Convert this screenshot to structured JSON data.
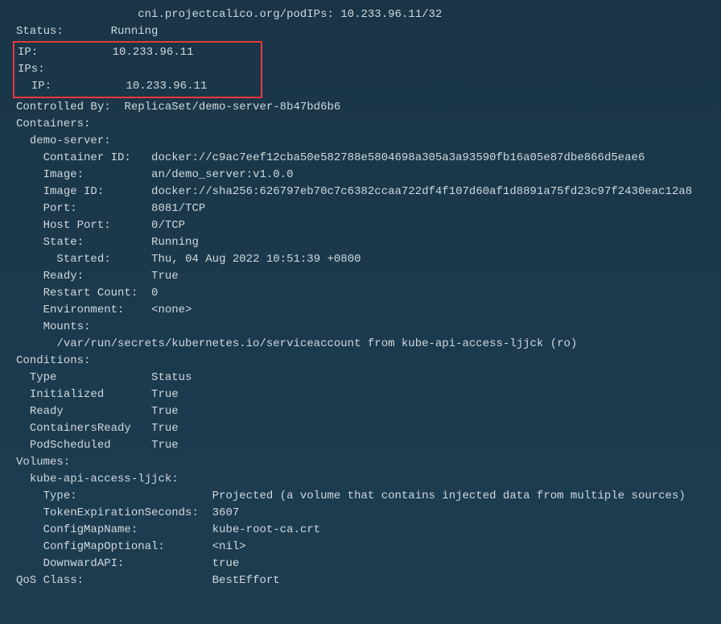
{
  "annotation": {
    "key": "cni.projectcalico.org/podIPs:",
    "value": "10.233.96.11/32"
  },
  "status": {
    "label": "Status:",
    "value": "Running"
  },
  "ip_section": {
    "ip_label": "IP:",
    "ip_value": "10.233.96.11",
    "ips_label": "IPs:",
    "nested_ip_label": "IP:",
    "nested_ip_value": "10.233.96.11"
  },
  "controlled_by": {
    "label": "Controlled By:",
    "value": "ReplicaSet/demo-server-8b47bd6b6"
  },
  "containers": {
    "label": "Containers:",
    "name": "demo-server:",
    "container_id": {
      "label": "Container ID:",
      "value": "docker://c9ac7eef12cba50e582788e5804698a305a3a93590fb16a05e87dbe866d5eae6"
    },
    "image": {
      "label": "Image:",
      "value": "an/demo_server:v1.0.0"
    },
    "image_id": {
      "label": "Image ID:",
      "value": "docker://sha256:626797eb70c7c6382ccaa722df4f107d60af1d8891a75fd23c97f2430eac12a8"
    },
    "port": {
      "label": "Port:",
      "value": "8081/TCP"
    },
    "host_port": {
      "label": "Host Port:",
      "value": "0/TCP"
    },
    "state": {
      "label": "State:",
      "value": "Running"
    },
    "started": {
      "label": "Started:",
      "value": "Thu, 04 Aug 2022 10:51:39 +0800"
    },
    "ready": {
      "label": "Ready:",
      "value": "True"
    },
    "restart_count": {
      "label": "Restart Count:",
      "value": "0"
    },
    "environment": {
      "label": "Environment:",
      "value": "<none>"
    },
    "mounts": {
      "label": "Mounts:",
      "value": "/var/run/secrets/kubernetes.io/serviceaccount from kube-api-access-ljjck (ro)"
    }
  },
  "conditions": {
    "label": "Conditions:",
    "header_type": "Type",
    "header_status": "Status",
    "rows": {
      "initialized": {
        "type": "Initialized",
        "status": "True"
      },
      "ready": {
        "type": "Ready",
        "status": "True"
      },
      "containers_ready": {
        "type": "ContainersReady",
        "status": "True"
      },
      "pod_scheduled": {
        "type": "PodScheduled",
        "status": "True"
      }
    }
  },
  "volumes": {
    "label": "Volumes:",
    "name": "kube-api-access-ljjck:",
    "type": {
      "label": "Type:",
      "value": "Projected (a volume that contains injected data from multiple sources)"
    },
    "token_expiration": {
      "label": "TokenExpirationSeconds:",
      "value": "3607"
    },
    "config_map_name": {
      "label": "ConfigMapName:",
      "value": "kube-root-ca.crt"
    },
    "config_map_optional": {
      "label": "ConfigMapOptional:",
      "value": "<nil>"
    },
    "downward_api": {
      "label": "DownwardAPI:",
      "value": "true"
    }
  },
  "qos_class": {
    "label": "QoS Class:",
    "value": "BestEffort"
  }
}
